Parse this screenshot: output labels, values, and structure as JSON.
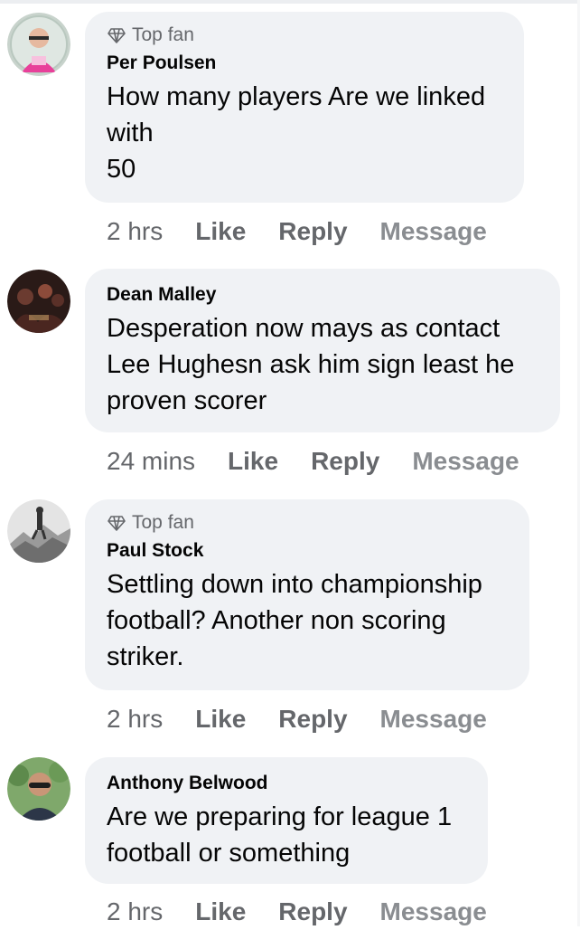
{
  "comments": [
    {
      "top_fan": true,
      "badge": "Top fan",
      "author": "Per Poulsen",
      "text": "How many players Are we linked\nwith\n50",
      "time": "2 hrs",
      "like": "Like",
      "reply": "Reply",
      "message": "Message"
    },
    {
      "top_fan": false,
      "badge": "",
      "author": "Dean Malley",
      "text": "Desperation now mays as contact\nLee Hughesn ask him sign  least he\nproven scorer",
      "time": "24 mins",
      "like": "Like",
      "reply": "Reply",
      "message": "Message"
    },
    {
      "top_fan": true,
      "badge": "Top fan",
      "author": "Paul Stock",
      "text": "Settling down into championship\nfootball? Another non scoring\nstriker.",
      "time": "2 hrs",
      "like": "Like",
      "reply": "Reply",
      "message": "Message"
    },
    {
      "top_fan": false,
      "badge": "",
      "author": "Anthony Belwood",
      "text": "Are we preparing for league 1\nfootball or something",
      "time": "2 hrs",
      "like": "Like",
      "reply": "Reply",
      "message": "Message"
    }
  ],
  "colors": {
    "bubble": "#f0f2f5",
    "text": "#050505",
    "meta": "#65676b"
  }
}
